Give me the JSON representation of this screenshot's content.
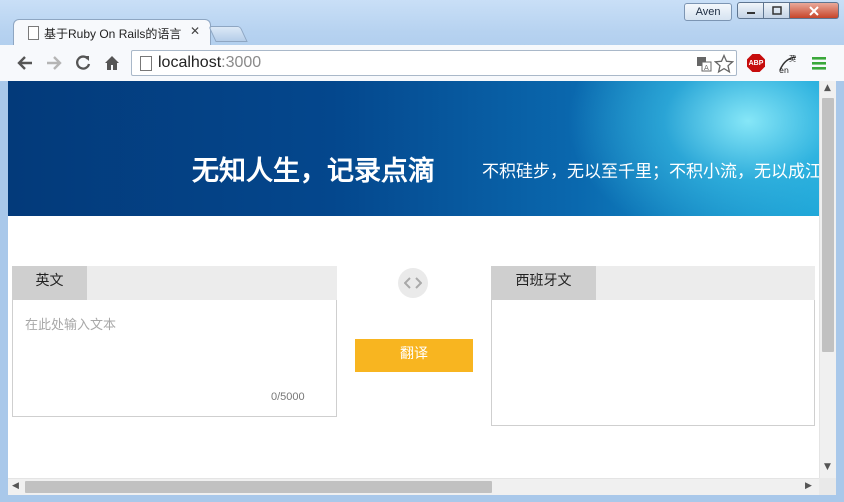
{
  "browser": {
    "profile_name": "Aven",
    "tab_title": "基于Ruby On Rails的语言",
    "url_host": "localhost",
    "url_port": ":3000"
  },
  "banner": {
    "title": "无知人生，记录点滴",
    "motto": "不积硅步，无以至千里；不积小流，无以成江海"
  },
  "translator": {
    "source_lang": "英文",
    "target_lang": "西班牙文",
    "input_placeholder": "在此处输入文本",
    "input_value": "",
    "char_count": "0/5000",
    "translate_label": "翻译",
    "output_text": ""
  },
  "colors": {
    "accent": "#f8b520",
    "banner_dark": "#033a7a",
    "banner_light": "#1aa3d6",
    "lang_tab": "#cfcfcf"
  },
  "icons": [
    "page-icon",
    "close-icon",
    "back-arrow-icon",
    "forward-arrow-icon",
    "reload-icon",
    "home-icon",
    "translate-page-icon",
    "star-icon",
    "adblock-icon",
    "dictionary-extension-icon",
    "menu-icon",
    "swap-languages-icon"
  ]
}
